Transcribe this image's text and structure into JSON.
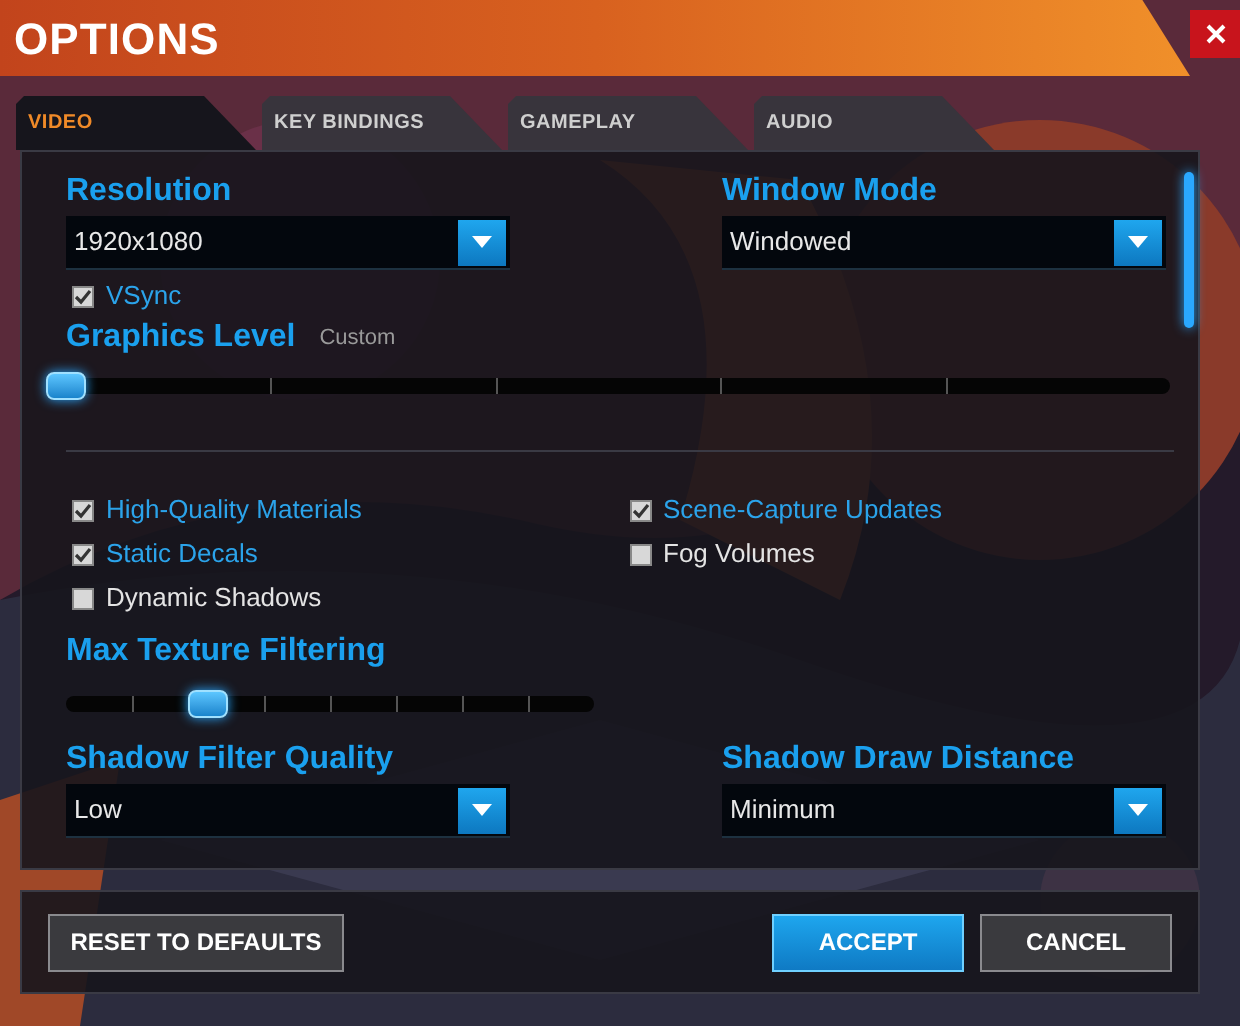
{
  "window": {
    "title": "OPTIONS"
  },
  "tabs": [
    {
      "label": "VIDEO",
      "selected": true
    },
    {
      "label": "KEY BINDINGS",
      "selected": false
    },
    {
      "label": "GAMEPLAY",
      "selected": false
    },
    {
      "label": "AUDIO",
      "selected": false
    }
  ],
  "resolution": {
    "label": "Resolution",
    "value": "1920x1080"
  },
  "window_mode": {
    "label": "Window Mode",
    "value": "Windowed"
  },
  "vsync": {
    "label": "VSync",
    "checked": true
  },
  "graphics_level": {
    "label": "Graphics Level",
    "reading": "Custom",
    "level": 0
  },
  "options": [
    {
      "label": "High-Quality Materials",
      "checked": true
    },
    {
      "label": "Scene-Capture Updates",
      "checked": true
    },
    {
      "label": "Static Decals",
      "checked": true
    },
    {
      "label": "Fog Volumes",
      "checked": false
    },
    {
      "label": "Dynamic Shadows",
      "checked": false
    }
  ],
  "max_texture_filtering": {
    "label": "Max Texture Filtering",
    "level": 0.25
  },
  "shadow_filter_quality": {
    "label": "Shadow Filter Quality",
    "value": "Low"
  },
  "shadow_draw_distance": {
    "label": "Shadow Draw Distance",
    "value": "Minimum"
  },
  "buttons": [
    {
      "label": "RESET TO DEFAULTS",
      "kind": "plain"
    },
    {
      "label": "ACCEPT",
      "kind": "primary"
    },
    {
      "label": "CANCEL",
      "kind": "plain"
    }
  ]
}
